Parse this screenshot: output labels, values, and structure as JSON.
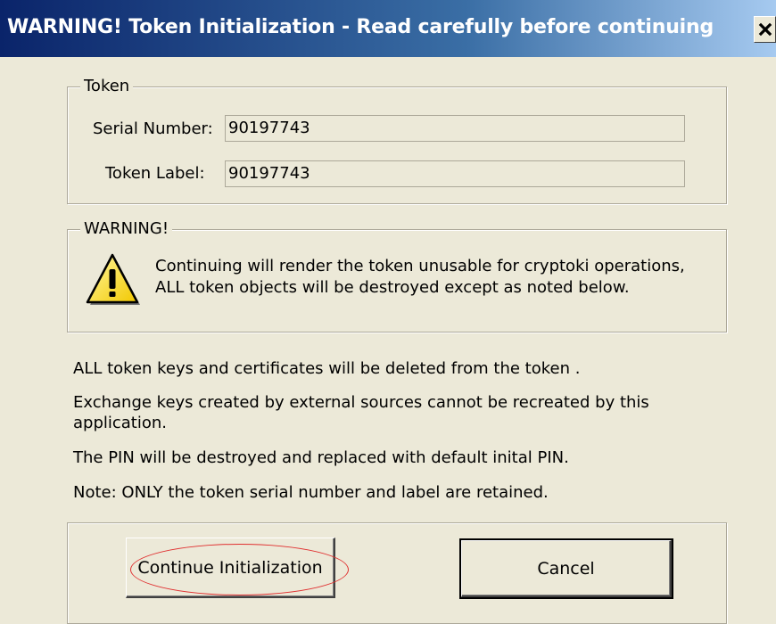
{
  "window": {
    "title": "WARNING!  Token Initialization  - Read carefully before continuing",
    "close_label": "✕"
  },
  "token_group": {
    "legend": "Token",
    "serial_label": "Serial Number:",
    "serial_value": "90197743",
    "token_label_label": "Token Label:",
    "token_label_value": "90197743"
  },
  "warning_group": {
    "legend": "WARNING!",
    "icon": "warning-triangle-icon",
    "line1": "Continuing will render the token unusable for cryptoki operations,",
    "line2": "ALL token objects will be destroyed except as noted below."
  },
  "notes": [
    "ALL token keys and certificates will be deleted from the token .",
    "Exchange keys created by external sources cannot be recreated by this",
    "application.",
    "The PIN will be destroyed and replaced with default inital PIN.",
    "Note: ONLY the token serial number and label are retained."
  ],
  "buttons": {
    "continue": "Continue Initialization",
    "cancel": "Cancel"
  },
  "colors": {
    "title_gradient_start": "#0a246a",
    "title_gradient_end": "#a6caf0",
    "dialog_bg": "#ece9d8",
    "highlight": "#e03030"
  }
}
